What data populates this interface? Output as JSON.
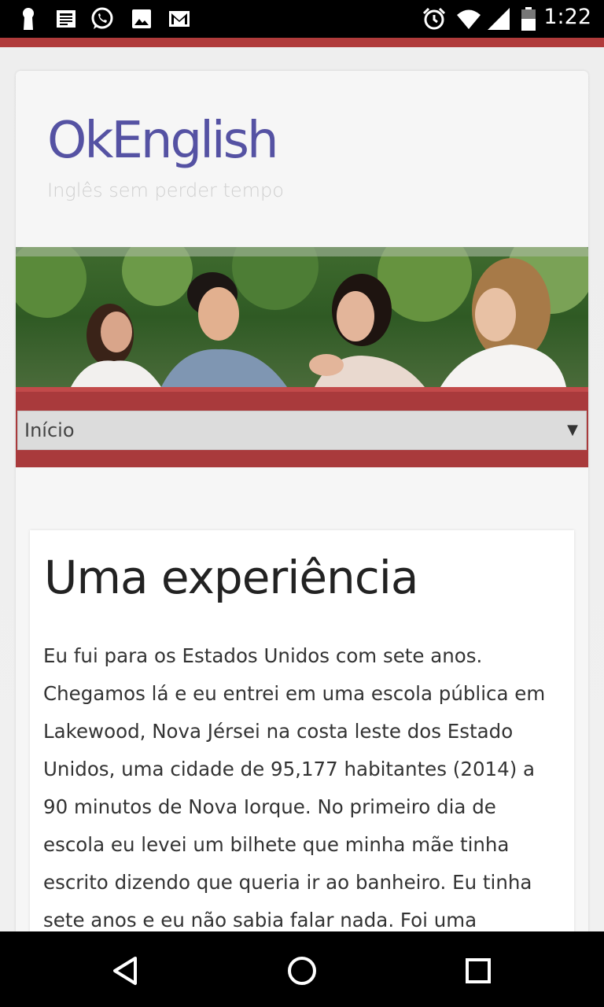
{
  "status_bar": {
    "time": "1:22",
    "left_icons": [
      "keyhole-icon",
      "news-icon",
      "whatsapp-icon",
      "image-icon",
      "gmail-icon"
    ],
    "right_icons": [
      "alarm-icon",
      "wifi-icon",
      "signal-icon",
      "battery-icon"
    ]
  },
  "site": {
    "title": "OkEnglish",
    "tagline": "Inglês sem perder tempo"
  },
  "nav": {
    "selected": "Início"
  },
  "article": {
    "title": "Uma experiência",
    "body": "Eu fui para os Estados Unidos com sete anos. Chegamos lá e eu entrei em uma escola pública em Lakewood, Nova Jérsei na costa leste dos Estado Unidos, uma cidade de 95,177 habitantes (2014) a 90 minutos de Nova Iorque. No primeiro dia de escola eu levei um bilhete que minha mãe tinha escrito dizendo que queria ir ao banheiro. Eu tinha sete anos e eu não sabia falar nada. Foi uma"
  },
  "colors": {
    "brand": "#5552a3",
    "accent_red": "#a93a3c",
    "tagline": "#cfcfcf"
  },
  "android_nav": [
    "back-icon",
    "home-icon",
    "recents-icon"
  ]
}
